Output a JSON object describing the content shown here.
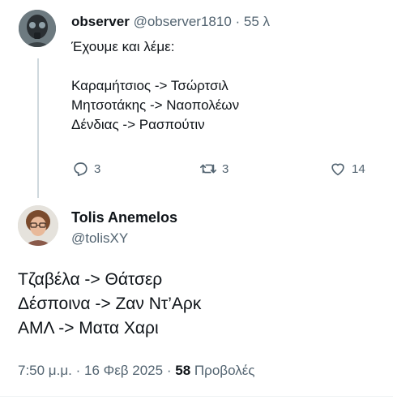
{
  "tweet1": {
    "name": "observer",
    "handle": "@observer1810",
    "separator": "·",
    "time": "55 λ",
    "lines": [
      "Έχουμε και λέμε:",
      "",
      "Καραμήτσιος -> Τσώρτσιλ",
      "Μητσοτάκης -> Ναοπολέων",
      "Δένδιας -> Ρασπούτιν"
    ],
    "actions": {
      "reply_icon": "reply-icon",
      "replies": "3",
      "retweet_icon": "retweet-icon",
      "retweets": "3",
      "like_icon": "heart-icon",
      "likes": "14"
    }
  },
  "tweet2": {
    "name": "Tolis Anemelos",
    "handle": "@tolisXY",
    "lines": [
      "Τζαβέλα -> Θάτσερ",
      "Δέσποινα -> Ζαν Ντ’Αρκ",
      "ΑΜΛ -> Ματα Χαρι"
    ],
    "time": "7:50 μ.μ.",
    "date": "16 Φεβ 2025",
    "views": "58",
    "views_label": "Προβολές",
    "separator": "·"
  },
  "colors": {
    "text": "#0f1419",
    "muted": "#536471",
    "thread_line": "#cfd9de"
  }
}
